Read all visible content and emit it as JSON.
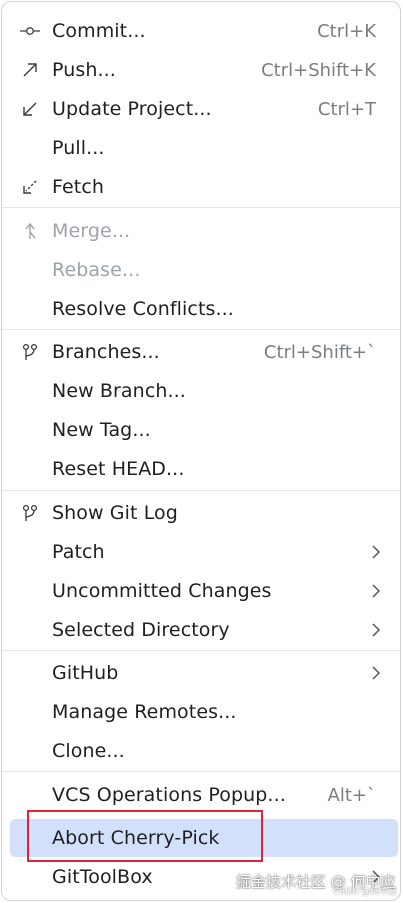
{
  "menu": {
    "items": [
      {
        "label": "Commit...",
        "shortcut": "Ctrl+K",
        "icon": "commit-icon"
      },
      {
        "label": "Push...",
        "shortcut": "Ctrl+Shift+K",
        "icon": "push-arrow-icon"
      },
      {
        "label": "Update Project...",
        "shortcut": "Ctrl+T",
        "icon": "update-arrow-icon"
      },
      {
        "label": "Pull..."
      },
      {
        "label": "Fetch",
        "icon": "fetch-icon"
      },
      {
        "label": "Merge...",
        "icon": "merge-icon",
        "disabled": true
      },
      {
        "label": "Rebase...",
        "disabled": true
      },
      {
        "label": "Resolve Conflicts..."
      },
      {
        "label": "Branches...",
        "shortcut": "Ctrl+Shift+`",
        "icon": "branch-icon"
      },
      {
        "label": "New Branch..."
      },
      {
        "label": "New Tag..."
      },
      {
        "label": "Reset HEAD..."
      },
      {
        "label": "Show Git Log",
        "icon": "git-log-icon"
      },
      {
        "label": "Patch",
        "submenu": true
      },
      {
        "label": "Uncommitted Changes",
        "submenu": true
      },
      {
        "label": "Selected Directory",
        "submenu": true
      },
      {
        "label": "GitHub",
        "submenu": true
      },
      {
        "label": "Manage Remotes..."
      },
      {
        "label": "Clone..."
      },
      {
        "label": "VCS Operations Popup...",
        "shortcut": "Alt+`"
      },
      {
        "label": "Abort Cherry-Pick",
        "selected": true
      },
      {
        "label": "GitToolBox",
        "submenu": true
      }
    ]
  },
  "watermark": {
    "main": "掘金技术社区 @ 何中应",
    "small": "CSDN @何中应"
  },
  "colors": {
    "selection": "#d3e0fb",
    "annotation_border": "#d9263a",
    "disabled_text": "#9ea3aa",
    "shortcut_text": "#7a7d83"
  }
}
